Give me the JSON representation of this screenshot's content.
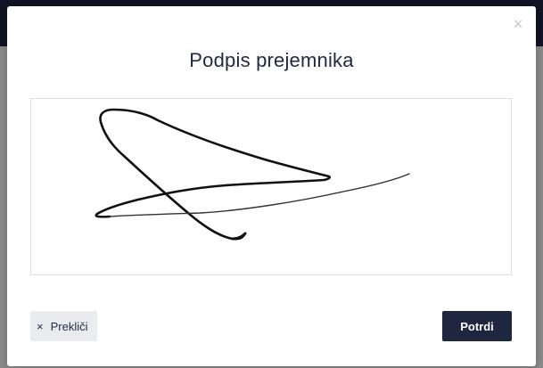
{
  "modal": {
    "title": "Podpis prejemnika",
    "close_icon": "close-icon",
    "cancel_label": "Prekliči",
    "confirm_label": "Potrdi"
  },
  "colors": {
    "primary": "#1e2640",
    "text": "#1e2a45",
    "cancel_bg": "#e9ebee"
  }
}
